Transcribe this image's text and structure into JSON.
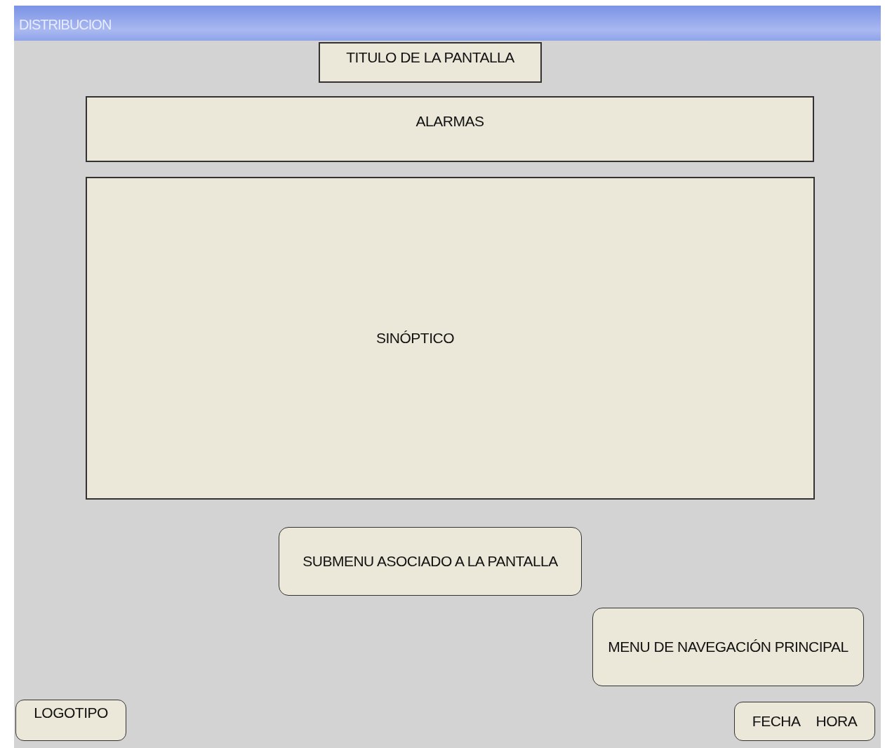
{
  "window": {
    "title": "DISTRIBUCION"
  },
  "screen_title": "TITULO DE LA PANTALLA",
  "alarms": "ALARMAS",
  "synoptic": "SINÓPTICO",
  "submenu": "SUBMENU ASOCIADO A LA PANTALLA",
  "main_menu": "MENU DE NAVEGACIÓN PRINCIPAL",
  "logo": "LOGOTIPO",
  "date": "FECHA",
  "time": "HORA"
}
